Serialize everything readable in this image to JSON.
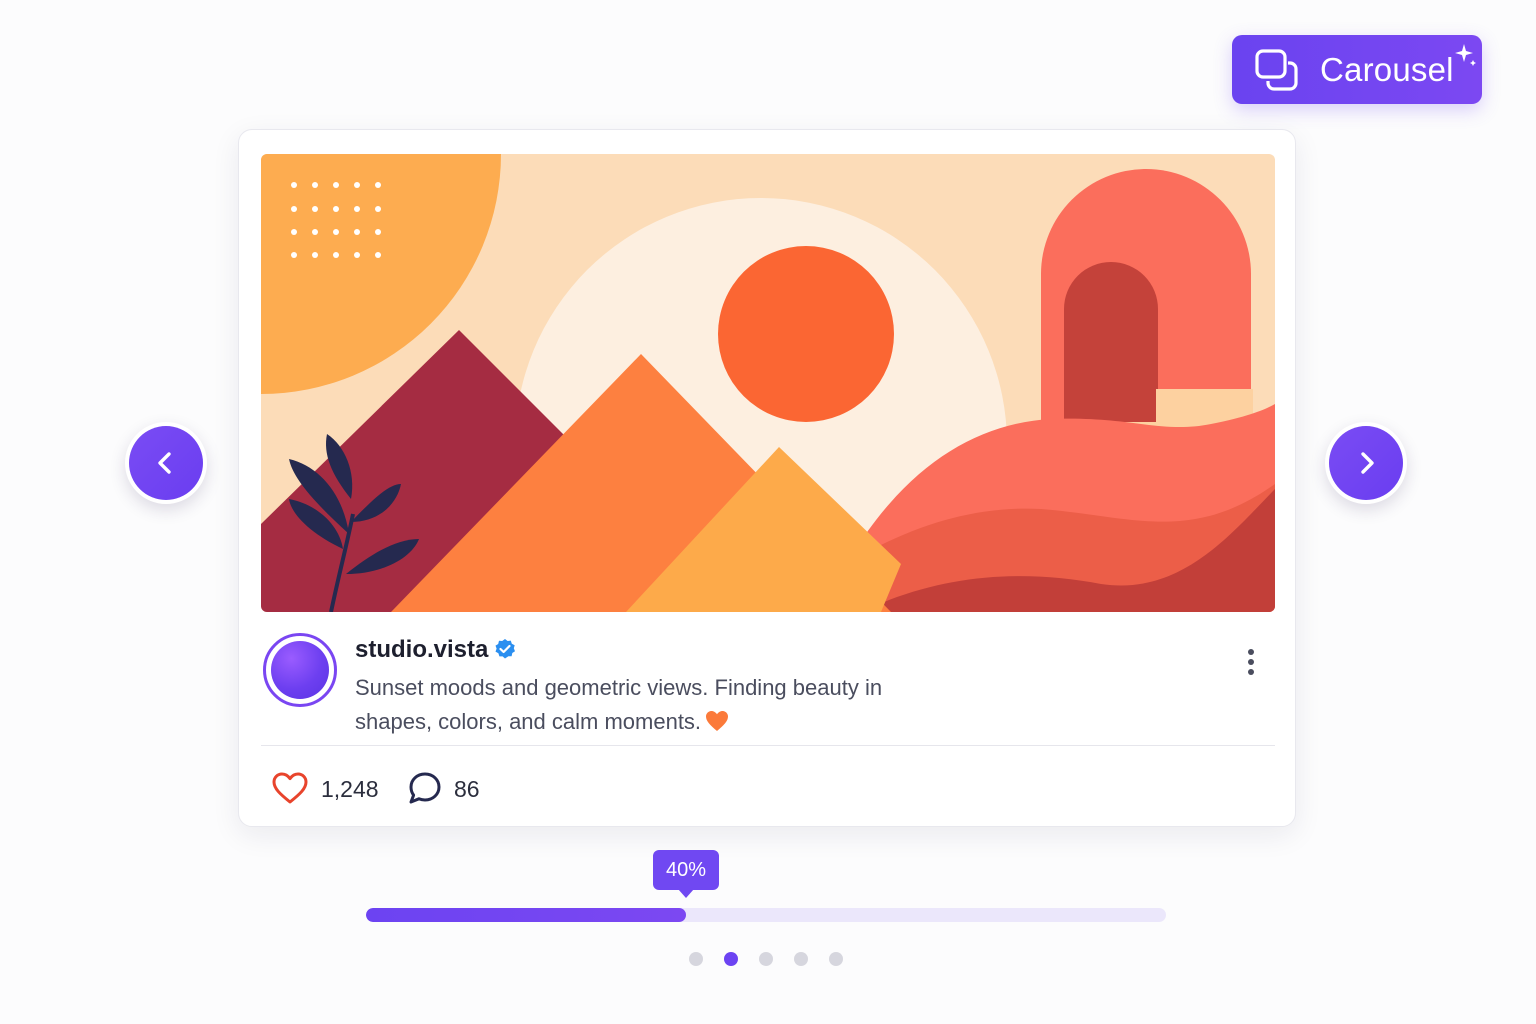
{
  "badge": {
    "label": "Carousel",
    "icon": "carousel-stack-icon",
    "sparkle_icon": "sparkle-icon"
  },
  "post": {
    "username": "studio.vista",
    "verified": true,
    "caption": "Sunset moods and geometric views. Finding beauty in shapes, colors, and calm moments.",
    "caption_emoji": "heart-emoji",
    "likes": "1,248",
    "comments": "86",
    "image_description_icon": "geometric-sunset-illustration"
  },
  "navigation": {
    "prev_icon": "chevron-left-icon",
    "next_icon": "chevron-right-icon"
  },
  "progress": {
    "label": "40%",
    "fraction": 0.4
  },
  "pagination": {
    "total": 5,
    "active_index": 1
  },
  "colors": {
    "accent": "#6c43f2",
    "like": "#e8442c",
    "text_dark": "#1d1f2e",
    "text_muted": "#4a4d5e"
  }
}
